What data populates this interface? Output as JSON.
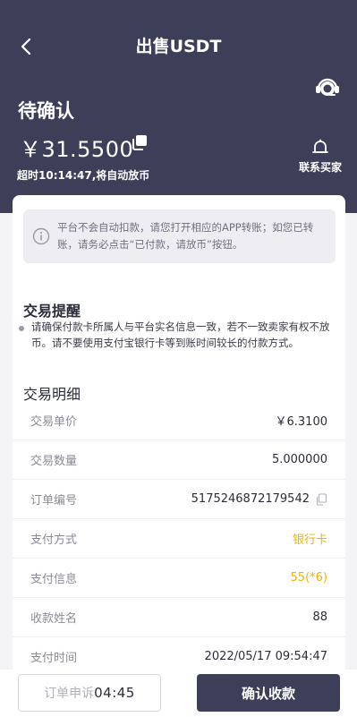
{
  "header": {
    "title": "出售USDT",
    "status": "待确认",
    "amount": "￥31.5500",
    "countdown": "超时10:14:47,将自动放币",
    "contact_label": "联系买家"
  },
  "notice": {
    "text": "平台不会自动扣款，请您打开相应的APP转账；如您已转账，请务必点击“已付款，请放币”按钮。"
  },
  "tips": {
    "title": "交易提醒",
    "text": "请确保付款卡所属人与平台实名信息一致，若不一致卖家有权不放币。请不要使用支付宝银行卡等到账时间较长的付款方式。"
  },
  "details": {
    "title": "交易明细",
    "rows": [
      {
        "label": "交易单价",
        "value": "￥6.3100"
      },
      {
        "label": "交易数量",
        "value": "5.000000"
      },
      {
        "label": "订单编号",
        "value": "5175246872179542"
      },
      {
        "label": "支付方式",
        "value": "银行卡"
      },
      {
        "label": "支付信息",
        "value": "55(*6)"
      },
      {
        "label": "收款姓名",
        "value": "88"
      },
      {
        "label": "支付时间",
        "value": "2022/05/17 09:54:47"
      }
    ]
  },
  "actions": {
    "appeal_label": "订单申诉",
    "appeal_timer": "04:45",
    "confirm_label": "确认收款"
  },
  "colors": {
    "header_bg": "#3d3f58",
    "accent": "#f2b200"
  },
  "icons": [
    "back-arrow-icon",
    "customer-service-icon",
    "copy-icon",
    "bell-icon",
    "info-icon"
  ]
}
